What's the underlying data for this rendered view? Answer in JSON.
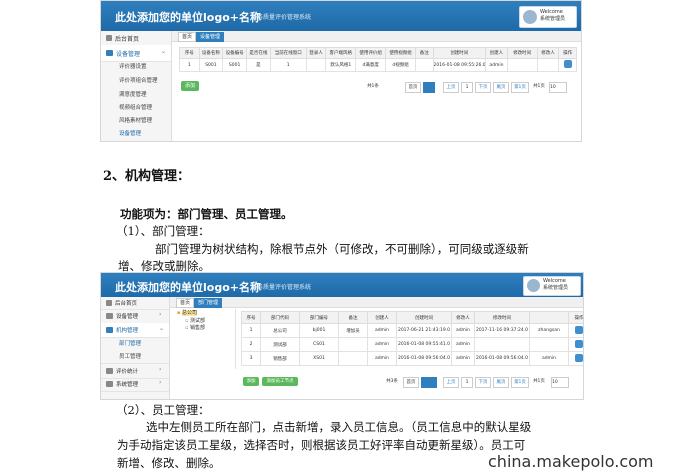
{
  "shot1": {
    "logo_title": "此处添加您的单位logo+名称",
    "system_name": "服务质量评价管理系统",
    "user_line1": "Welcome",
    "user_line2": "系统管理员",
    "sidebar": {
      "home": "后台首页",
      "group": "设备管理",
      "subitems": [
        "评价器设置",
        "评价项组合管理",
        "满意度管理",
        "视频组合管理",
        "风格素材管理",
        "设备管理"
      ]
    },
    "tabs": [
      "首页",
      "设备管理"
    ],
    "table": {
      "headers": [
        "序号",
        "设备名称",
        "设备编号",
        "是否在线",
        "当前在线窗口",
        "登录人",
        "客户端风格",
        "使用评价组",
        "使用视频组",
        "备注",
        "创建时间",
        "创建人",
        "修改时间",
        "修改人",
        "操作"
      ],
      "rows": [
        [
          "1",
          "S001",
          "S001",
          "是",
          "1",
          "",
          "默认风格1",
          "d满意度",
          "d视频组",
          "",
          "2016-01-08 09:55:26.0",
          "admin",
          "",
          "",
          ""
        ]
      ]
    },
    "add_button": "添加",
    "pager": {
      "total": "共1条",
      "first": "首页",
      "prev": "上页",
      "page": "1",
      "next": "下页",
      "last": "尾页",
      "jump": "第1页",
      "of": "共1页",
      "size": "10"
    }
  },
  "section": {
    "heading": "2、机构管理：",
    "func_label": "功能项为：部门管理、员工管理。",
    "item1": "（1）、部门管理：",
    "para1_line1": "部门管理为树状结构，除根节点外（可修改，不可删除），可同级或逐级新",
    "para1_line2": "增、修改或删除。",
    "item2": "（2）、员工管理：",
    "para2_line1": "选中左侧员工所在部门，点击新增，录入员工信息。（员工信息中的默认星级",
    "para2_line2": "为手动指定该员工星级，选择否时，则根据该员工好评率自动更新星级）。员工可",
    "para2_line3": "新增、修改、删除。"
  },
  "shot2": {
    "logo_title": "此处添加您的单位logo+名称",
    "system_name": "服务质量评价管理系统",
    "user_line1": "Welcome",
    "user_line2": "系统管理员",
    "sidebar": {
      "home": "后台首页",
      "group1": "设备管理",
      "group2": "机构管理",
      "subitems": [
        "部门管理",
        "员工管理"
      ],
      "group3": "评价统计",
      "group4": "系统管理"
    },
    "tabs": [
      "首页",
      "部门管理"
    ],
    "tree": {
      "root": "总公司",
      "children": [
        "测试部",
        "销售部"
      ]
    },
    "table": {
      "headers": [
        "序号",
        "部门代码",
        "部门编号",
        "备注",
        "创建人",
        "创建时间",
        "修改人",
        "修改时间",
        "操作"
      ],
      "rows": [
        [
          "1",
          "总公司",
          "bj001",
          "增加员",
          "admin",
          "2017-06-21 21:43:19.0",
          "admin",
          "2017-11-16 09:37:24.0",
          "zhangsan"
        ],
        [
          "2",
          "测试部",
          "CS01",
          "",
          "admin",
          "2016-01-08 09:55:41.0",
          "admin",
          "",
          ""
        ],
        [
          "3",
          "销售部",
          "XS01",
          "",
          "admin",
          "2016-01-08 09:56:04.0",
          "admin",
          "2016-01-08 09:56:04.0",
          "admin"
        ]
      ]
    },
    "add_button": "添加",
    "add_sub_button": "添加员工节点",
    "pager": {
      "total": "共3条",
      "first": "首页",
      "prev": "上页",
      "page": "1",
      "next": "下页",
      "last": "尾页",
      "jump": "第1页",
      "of": "共1页",
      "size": "10"
    }
  },
  "watermark": "china.makepolo.com"
}
